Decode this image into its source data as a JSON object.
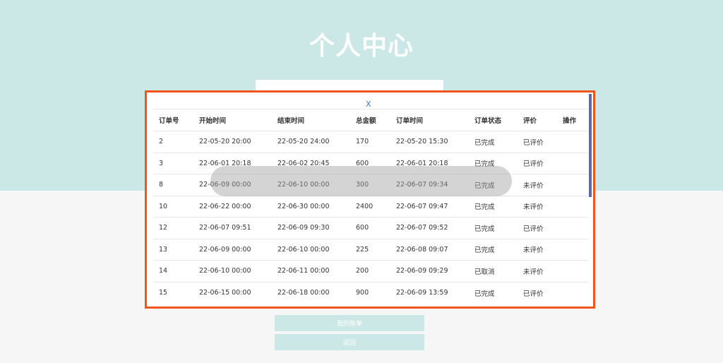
{
  "page": {
    "title": "个人中心"
  },
  "modal": {
    "close_label": "X",
    "columns": [
      "订单号",
      "开始时间",
      "结束时间",
      "总金额",
      "订单时间",
      "订单状态",
      "评价",
      "操作"
    ],
    "rows": [
      [
        "2",
        "22-05-20 20:00",
        "22-05-20 24:00",
        "170",
        "22-05-20 15:30",
        "已完成",
        "已评价",
        ""
      ],
      [
        "3",
        "22-06-01 20:18",
        "22-06-02 20:45",
        "600",
        "22-06-01 20:18",
        "已完成",
        "已评价",
        ""
      ],
      [
        "8",
        "22-06-09 00:00",
        "22-06-10 00:00",
        "300",
        "22-06-07 09:34",
        "已完成",
        "未评价",
        ""
      ],
      [
        "10",
        "22-06-22 00:00",
        "22-06-30 00:00",
        "2400",
        "22-06-07 09:47",
        "已完成",
        "未评价",
        ""
      ],
      [
        "12",
        "22-06-07 09:51",
        "22-06-09 09:30",
        "600",
        "22-06-07 09:52",
        "已完成",
        "已评价",
        ""
      ],
      [
        "13",
        "22-06-09 00:00",
        "22-06-10 00:00",
        "225",
        "22-06-08 09:07",
        "已完成",
        "未评价",
        ""
      ],
      [
        "14",
        "22-06-10 00:00",
        "22-06-11 00:00",
        "200",
        "22-06-09 09:29",
        "已取消",
        "未评价",
        ""
      ],
      [
        "15",
        "22-06-15 00:00",
        "22-06-18 00:00",
        "900",
        "22-06-09 13:59",
        "已完成",
        "已评价",
        ""
      ]
    ]
  },
  "buttons": {
    "orders": "我的账单",
    "back": "返回"
  },
  "colors": {
    "hero": "#cbe8e6",
    "border": "#f0561c",
    "close": "#3e74d6",
    "scrollbar": "#5f6aa6"
  }
}
